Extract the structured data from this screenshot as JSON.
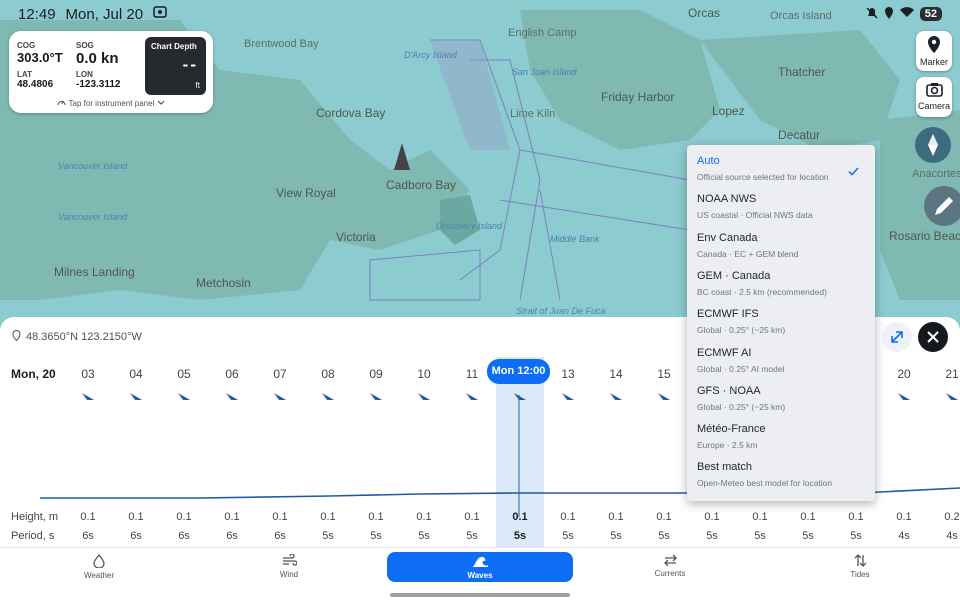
{
  "status_bar": {
    "time": "12:49",
    "date": "Mon, Jul 20",
    "battery": "52"
  },
  "map": {
    "labels": [
      "Orcas",
      "Orcas Island",
      "English Camp",
      "Brentwood Bay",
      "D'Arcy Island",
      "San Juan Island",
      "Thatcher",
      "Cordova Bay",
      "Friday Harbor",
      "Lime Kiln",
      "Lopez",
      "Decatur",
      "Vancouver Island",
      "View Royal",
      "Cadboro Bay",
      "Anacortes",
      "Discovery Island",
      "Vancouver Island",
      "Victoria",
      "Middle Bank",
      "Rosario Beach",
      "Milnes Landing",
      "Metchosin",
      "Strait of Juan De Fuca"
    ]
  },
  "instrument_panel": {
    "cog_label": "COG",
    "cog_value": "303.0°T",
    "sog_label": "SOG",
    "sog_value": "0.0 kn",
    "lat_label": "LAT",
    "lat_value": "48.4806",
    "lon_label": "LON",
    "lon_value": "-123.3112",
    "depth_title": "Chart Depth",
    "depth_value": "--",
    "depth_unit": "ft",
    "tap_text": "Tap for instrument panel"
  },
  "map_buttons": {
    "marker": "Marker",
    "camera": "Camera"
  },
  "panel": {
    "location": "48.3650°N 123.2150°W",
    "day_label": "Mon, 20",
    "hours": [
      "03",
      "04",
      "05",
      "06",
      "07",
      "08",
      "09",
      "10",
      "11",
      "Mon 12:00",
      "13",
      "14",
      "15",
      "16",
      "17",
      "18",
      "19",
      "20",
      "21"
    ],
    "selected_index": 9,
    "height_label": "Height, m",
    "period_label": "Period, s",
    "heights": [
      "0.1",
      "0.1",
      "0.1",
      "0.1",
      "0.1",
      "0.1",
      "0.1",
      "0.1",
      "0.1",
      "0.1",
      "0.1",
      "0.1",
      "0.1",
      "0.1",
      "0.1",
      "0.1",
      "0.1",
      "0.1",
      "0.2"
    ],
    "periods": [
      "6s",
      "6s",
      "6s",
      "6s",
      "6s",
      "5s",
      "5s",
      "5s",
      "5s",
      "5s",
      "5s",
      "5s",
      "5s",
      "5s",
      "5s",
      "5s",
      "5s",
      "4s",
      "4s"
    ]
  },
  "bottom_nav": {
    "tabs": [
      {
        "label": "Weather",
        "icon": "drop-icon"
      },
      {
        "label": "Wind",
        "icon": "wind-icon"
      },
      {
        "label": "Waves",
        "icon": "wave-icon"
      },
      {
        "label": "Currents",
        "icon": "swap-icon"
      },
      {
        "label": "Tides",
        "icon": "updown-icon"
      }
    ],
    "active": "Waves"
  },
  "source_menu": {
    "selected": "Auto",
    "options": [
      {
        "name": "Auto",
        "desc": "Official source selected for location"
      },
      {
        "name": "NOAA NWS",
        "desc": "US coastal · Official NWS data"
      },
      {
        "name": "Env Canada",
        "desc": "Canada · EC + GEM blend"
      },
      {
        "name": "GEM · Canada",
        "desc": "BC coast · 2.5 km (recommended)"
      },
      {
        "name": "ECMWF IFS",
        "desc": "Global · 0.25° (~25 km)"
      },
      {
        "name": "ECMWF AI",
        "desc": "Global · 0.25° AI model"
      },
      {
        "name": "GFS · NOAA",
        "desc": "Global · 0.25° (~25 km)"
      },
      {
        "name": "Météo-France",
        "desc": "Europe · 2.5 km"
      },
      {
        "name": "Best match",
        "desc": "Open-Meteo best model for location"
      }
    ]
  },
  "colors": {
    "accent": "#0d6ef5",
    "water": "#8ccbd0",
    "land": "#7fb9b2"
  }
}
